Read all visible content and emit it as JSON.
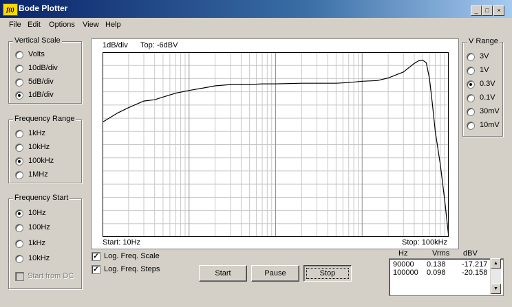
{
  "window": {
    "title": "Bode Plotter",
    "icon_text": "f(t)",
    "min": "_",
    "max": "□",
    "close": "×"
  },
  "menu": [
    "File",
    "Edit",
    "Options",
    "View",
    "Help"
  ],
  "vertical_scale": {
    "label": "Vertical Scale",
    "options": [
      "Volts",
      "10dB/div",
      "5dB/div",
      "1dB/div"
    ],
    "selected": 3
  },
  "frequency_range": {
    "label": "Frequency Range",
    "options": [
      "1kHz",
      "10kHz",
      "100kHz",
      "1MHz"
    ],
    "selected": 2
  },
  "frequency_start": {
    "label": "Frequency Start",
    "options": [
      "10Hz",
      "100Hz",
      "1kHz",
      "10kHz"
    ],
    "selected": 0,
    "start_from_dc": "Start from DC",
    "start_from_dc_checked": false
  },
  "v_range": {
    "label": "V Range",
    "options": [
      "3V",
      "1V",
      "0.3V",
      "0.1V",
      "30mV",
      "10mV"
    ],
    "selected": 2
  },
  "plot": {
    "scale_text": "1dB/div",
    "top_text": "Top: -6dBV",
    "start_text": "Start: 10Hz",
    "stop_text": "Stop: 100kHz"
  },
  "options": {
    "log_freq_scale": "Log. Freq. Scale",
    "log_freq_scale_checked": true,
    "log_freq_steps": "Log. Freq. Steps",
    "log_freq_steps_checked": true
  },
  "buttons": {
    "start": "Start",
    "pause": "Pause",
    "stop": "Stop"
  },
  "readings": {
    "headers": [
      "Hz",
      "Vrms",
      "dBV"
    ],
    "rows": [
      [
        "90000",
        "0.138",
        "-17.217"
      ],
      [
        "100000",
        "0.098",
        "-20.158"
      ]
    ]
  },
  "chart_data": {
    "type": "line",
    "x_scale": "log",
    "xlim": [
      10,
      100000
    ],
    "ylim": [
      -20,
      -6
    ],
    "grid": true,
    "x": [
      10,
      15,
      20,
      30,
      40,
      50,
      70,
      100,
      150,
      200,
      300,
      500,
      700,
      1000,
      2000,
      3000,
      5000,
      7000,
      10000,
      15000,
      20000,
      30000,
      40000,
      45000,
      50000,
      55000,
      60000,
      65000,
      70000,
      80000,
      90000,
      100000
    ],
    "series": [
      {
        "values": [
          -11.3,
          -10.6,
          -10.2,
          -9.7,
          -9.6,
          -9.4,
          -9.1,
          -8.9,
          -8.7,
          -8.55,
          -8.45,
          -8.45,
          -8.4,
          -8.4,
          -8.35,
          -8.35,
          -8.35,
          -8.3,
          -8.2,
          -8.15,
          -7.95,
          -7.5,
          -6.85,
          -6.65,
          -6.6,
          -6.8,
          -8.0,
          -10.0,
          -12.0,
          -14.5,
          -17.217,
          -20.158
        ]
      }
    ]
  }
}
